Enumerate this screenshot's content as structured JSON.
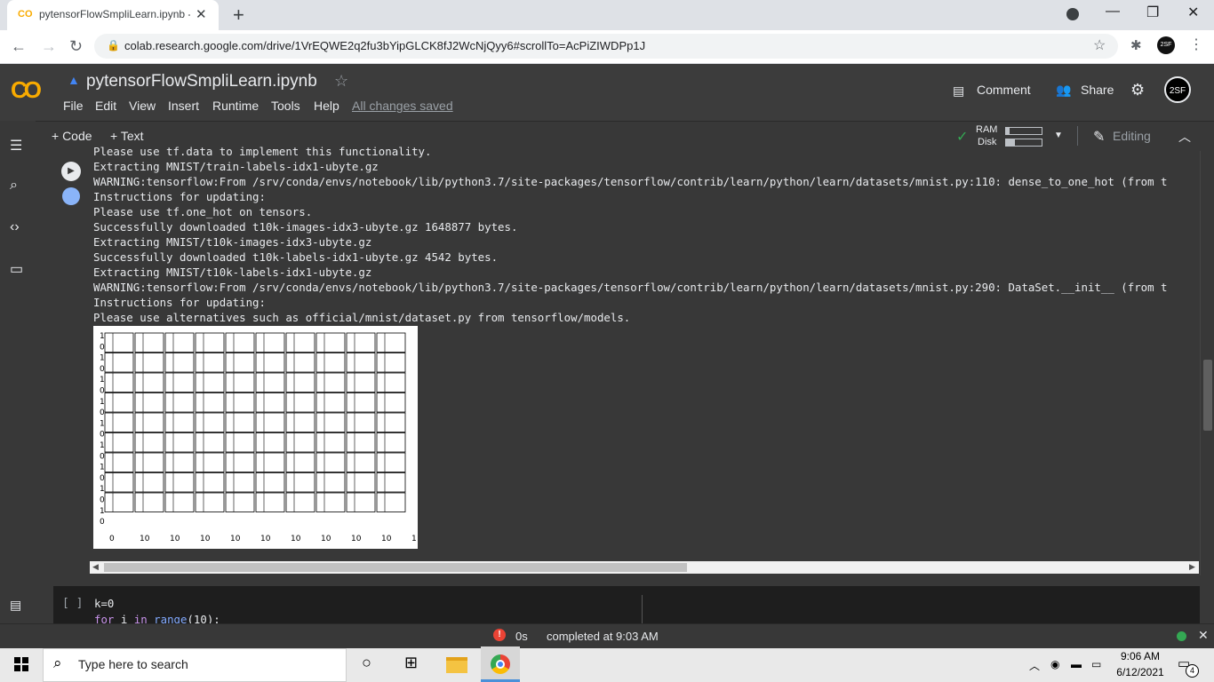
{
  "browser": {
    "tab_title": "pytensorFlowSmpliLearn.ipynb - ",
    "tab_close": "✕",
    "new_tab": "+",
    "url": "colab.research.google.com/drive/1VrEQWE2q2fu3bYipGLCK8fJ2WcNjQyy6#scrollTo=AcPiZIWDPp1J",
    "profile_initials": "2SF"
  },
  "colab": {
    "logo_text": "CO",
    "notebook_title": "pytensorFlowSmpliLearn.ipynb",
    "menu": [
      "File",
      "Edit",
      "View",
      "Insert",
      "Runtime",
      "Tools",
      "Help"
    ],
    "saved_status": "All changes saved",
    "comment_label": "Comment",
    "share_label": "Share",
    "account_initials": "2SF",
    "add_code_label": "+ Code",
    "add_text_label": "+ Text",
    "ram_label": "RAM",
    "disk_label": "Disk",
    "ram_usage_fraction": 0.1,
    "disk_usage_fraction": 0.25,
    "editing_label": "Editing"
  },
  "output_lines": [
    "Please use tf.data to implement this functionality.",
    "Extracting MNIST/train-labels-idx1-ubyte.gz",
    "WARNING:tensorflow:From /srv/conda/envs/notebook/lib/python3.7/site-packages/tensorflow/contrib/learn/python/learn/datasets/mnist.py:110: dense_to_one_hot (from t",
    "Instructions for updating:",
    "Please use tf.one_hot on tensors.",
    "Successfully downloaded t10k-images-idx3-ubyte.gz 1648877 bytes.",
    "Extracting MNIST/t10k-images-idx3-ubyte.gz",
    "Successfully downloaded t10k-labels-idx1-ubyte.gz 4542 bytes.",
    "Extracting MNIST/t10k-labels-idx1-ubyte.gz",
    "WARNING:tensorflow:From /srv/conda/envs/notebook/lib/python3.7/site-packages/tensorflow/contrib/learn/python/learn/datasets/mnist.py:290: DataSet.__init__ (from t",
    "Instructions for updating:",
    "Please use alternatives such as official/mnist/dataset.py from tensorflow/models."
  ],
  "plot": {
    "y_tick_labels": [
      "1",
      "0",
      "1",
      "0",
      "1",
      "0",
      "1",
      "0",
      "1",
      "0",
      "1",
      "0",
      "1",
      "0",
      "1",
      "0",
      "1",
      "0"
    ],
    "x_tick_labels": [
      "0",
      "10",
      "10",
      "10",
      "10",
      "10",
      "10",
      "10",
      "10",
      "10",
      "1"
    ]
  },
  "code_cell": {
    "brackets": "[ ]",
    "line1": "k=0",
    "line2_kw": "for",
    "line2_a": " i ",
    "line2_kw2": "in",
    "line2_fn": " range",
    "line2_b": "(10):"
  },
  "status": {
    "elapsed": "0s",
    "completed": "completed at 9:03 AM"
  },
  "taskbar": {
    "search_placeholder": "Type here to search",
    "time": "9:06 AM",
    "date": "6/12/2021",
    "notification_count": "4"
  }
}
